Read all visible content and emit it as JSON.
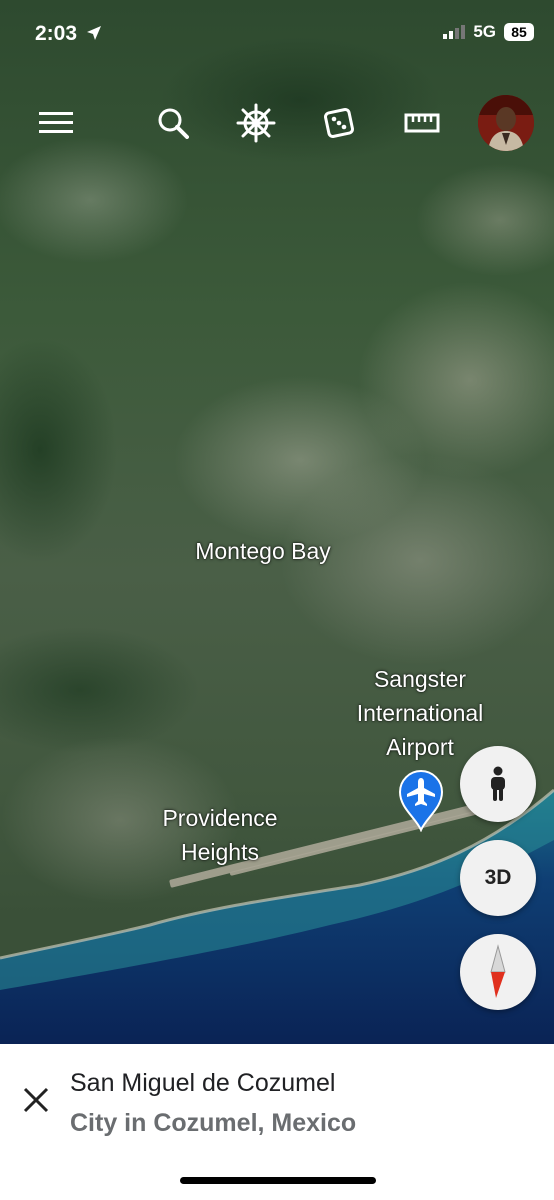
{
  "status_bar": {
    "time": "2:03",
    "network": "5G",
    "battery": "85"
  },
  "toolbar": {
    "icons": [
      "menu-icon",
      "search-icon",
      "voyager-wheel-icon",
      "feeling-lucky-dice-icon",
      "measure-ruler-icon",
      "profile-avatar"
    ]
  },
  "map": {
    "labels": {
      "montego_bay": "Montego Bay",
      "airport_line1": "Sangster",
      "airport_line2": "International",
      "airport_line3": "Airport",
      "providence_line1": "Providence",
      "providence_line2": "Heights"
    },
    "airport_pin_color": "#1a73e8"
  },
  "controls": {
    "street_view": "pegman-icon",
    "three_d_label": "3D",
    "compass": "compass-icon"
  },
  "bottom_sheet": {
    "title": "San Miguel de Cozumel",
    "subtitle": "City in Cozumel, Mexico"
  }
}
